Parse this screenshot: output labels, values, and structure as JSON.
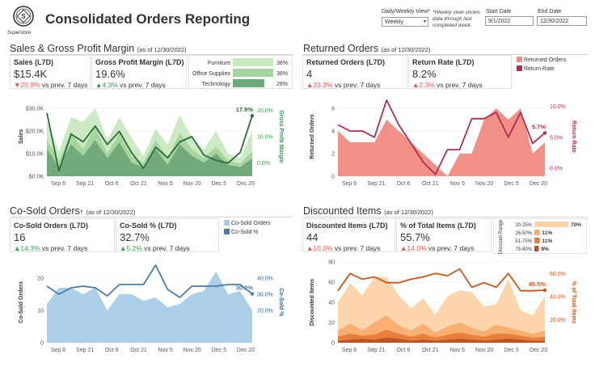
{
  "header": {
    "logo_text": "Superstore",
    "title": "Consolidated Orders Reporting",
    "view_label": "Daily/Weekly View*",
    "view_value": "Weekly",
    "note": "*Weekly view shows data through last completed week.",
    "start_label": "Start Date",
    "start_value": "9/1/2022",
    "end_label": "End Date",
    "end_value": "12/30/2022"
  },
  "sales": {
    "title": "Sales & Gross Profit Margin",
    "asof": "(as of 12/30/2022)",
    "kpi1": {
      "label": "Sales (L7D)",
      "value": "$15.4K",
      "arrow": "▼",
      "pct": "20.9%",
      "suffix": " vs prev. 7 days"
    },
    "kpi2": {
      "label": "Gross Profit Margin (L7D)",
      "value": "19.6%",
      "arrow": "▲",
      "pct": "4.3%",
      "suffix": " vs prev. 7 days"
    },
    "categories": [
      {
        "name": "Furniture",
        "pct": "36%",
        "share": 0.36,
        "color": "#c8e8c0"
      },
      {
        "name": "Office Supplies",
        "pct": "36%",
        "share": 0.36,
        "color": "#a3d49b"
      },
      {
        "name": "Technology",
        "pct": "28%",
        "share": 0.28,
        "color": "#6fa87a"
      }
    ]
  },
  "returns": {
    "title": "Returned Orders",
    "asof": "(as of 12/30/2022)",
    "kpi1": {
      "label": "Returned Orders (L7D)",
      "value": "4",
      "arrow": "▲",
      "pct": "33.3%",
      "suffix": " vs prev. 7 days"
    },
    "kpi2": {
      "label": "Return Rate (L7D)",
      "value": "8.2%",
      "arrow": "▲",
      "pct": "2.3%",
      "suffix": " vs prev. 7 days"
    },
    "legend": [
      {
        "name": "Returned Orders",
        "color": "#f08a80"
      },
      {
        "name": "Return Rate",
        "color": "#b32d4e"
      }
    ]
  },
  "cosold": {
    "title": "Co-Sold Orders",
    "dagger": "†",
    "asof": "(as of 12/30/2022)",
    "kpi1": {
      "label": "Co-Sold Orders (L7D)",
      "value": "16",
      "arrow": "▲",
      "pct": "14.3%",
      "suffix": " vs prev. 7 days"
    },
    "kpi2": {
      "label": "Co-Sold % (L7D)",
      "value": "32.7%",
      "arrow": "▲",
      "pct": "5.2%",
      "suffix": " vs prev. 7 days"
    },
    "legend": [
      {
        "name": "Co-Sold Orders",
        "color": "#a9cbe6"
      },
      {
        "name": "Co-Sold %",
        "color": "#4a7cab"
      }
    ]
  },
  "discount": {
    "title": "Discounted Items",
    "asof": "(as of 12/30/2022)",
    "kpi1": {
      "label": "Discounted Items (L7D)",
      "value": "44",
      "arrow": "▲",
      "pct": "10.0%",
      "suffix": " vs prev. 7 days"
    },
    "kpi2": {
      "label": "% of Total Items (L7D)",
      "value": "55.7%",
      "arrow": "▲",
      "pct": "14.0%",
      "suffix": " vs prev. 7 days"
    },
    "range_title": "Discount Range",
    "ranges": [
      {
        "name": "10-25%",
        "pct": "70%",
        "share": 0.7,
        "color": "#fcd3a8"
      },
      {
        "name": "26-50%",
        "pct": "11%",
        "share": 0.11,
        "color": "#f8ad6e"
      },
      {
        "name": "51-75%",
        "pct": "11%",
        "share": 0.11,
        "color": "#e67c3a"
      },
      {
        "name": "75-80%",
        "pct": "9%",
        "share": 0.09,
        "color": "#b5552a"
      }
    ]
  },
  "chart_data": [
    {
      "type": "area",
      "title": "Sales & Gross Profit Margin",
      "x_ticks": [
        "Sep 6",
        "Sep 21",
        "Oct 6",
        "Oct 21",
        "Nov 5",
        "Nov 20",
        "Dec 5",
        "Dec 20"
      ],
      "ylabel": "Sales",
      "ylim": [
        0,
        35000
      ],
      "y_ticks": [
        "$0.0K",
        "$10.0K",
        "$20.0K",
        "$30.0K"
      ],
      "y2label": "Gross Profit Margin",
      "y2lim": [
        -5,
        25
      ],
      "y2_ticks": [
        "0.0%",
        "10.0%",
        "20.0%"
      ],
      "stacked": true,
      "series": [
        {
          "name": "Technology",
          "color": "#6fa87a",
          "values": [
            12000,
            4000,
            14000,
            9000,
            16000,
            8000,
            15000,
            6000,
            4000,
            12000,
            5000,
            14000,
            9000,
            6000,
            10000,
            5000,
            4000,
            8000
          ]
        },
        {
          "name": "Office Supplies",
          "color": "#a3d49b",
          "values": [
            4000,
            3000,
            5000,
            3000,
            6000,
            2000,
            4000,
            3000,
            2000,
            4000,
            3000,
            5000,
            3000,
            2000,
            3000,
            2000,
            1500,
            3000
          ]
        },
        {
          "name": "Furniture",
          "color": "#c8e8c0",
          "values": [
            8000,
            4000,
            7000,
            12000,
            8000,
            6000,
            7000,
            8000,
            3000,
            5000,
            6000,
            8000,
            5000,
            4000,
            7000,
            3000,
            2500,
            9000
          ]
        }
      ],
      "line": {
        "name": "Gross Profit Margin",
        "color": "#2d6b3c",
        "values": [
          19,
          -3,
          11,
          8,
          14,
          7,
          12,
          4,
          -2,
          6,
          2,
          8,
          10,
          3,
          1,
          0,
          4,
          17.9
        ],
        "end_label": "17.9%"
      }
    },
    {
      "type": "area",
      "title": "Returned Orders",
      "x_ticks": [
        "Sep 6",
        "Sep 21",
        "Oct 6",
        "Oct 21",
        "Nov 5",
        "Nov 20",
        "Dec 5",
        "Dec 20"
      ],
      "ylabel": "Returned Orders",
      "ylim": [
        0,
        7
      ],
      "y_ticks": [
        "0",
        "2",
        "4",
        "6"
      ],
      "y2label": "Return Rate",
      "y2lim": [
        -1.3,
        11.5
      ],
      "y2_ticks": [
        "0.0%",
        "5.0%",
        "10.0%"
      ],
      "area": {
        "name": "Returned Orders",
        "color": "#f08a80",
        "values": [
          4,
          3,
          3,
          3,
          5,
          4,
          3,
          2,
          1,
          0,
          2,
          2,
          5,
          6,
          5,
          6,
          2,
          3
        ]
      },
      "line": {
        "name": "Return Rate",
        "color": "#b32d4e",
        "values": [
          7,
          6,
          6,
          5,
          11,
          7,
          4,
          1,
          -1,
          3,
          3,
          8,
          8,
          9,
          5,
          9,
          4,
          5.7
        ],
        "end_label": "5.7%"
      }
    },
    {
      "type": "area",
      "title": "Co-Sold Orders",
      "x_ticks": [
        "Sep 6",
        "Sep 21",
        "Oct 6",
        "Oct 21",
        "Nov 5",
        "Nov 20",
        "Dec 5",
        "Dec 20"
      ],
      "ylabel": "Co-Sold Orders",
      "ylim": [
        0,
        25
      ],
      "y_ticks": [
        "0",
        "10",
        "20"
      ],
      "y2label": "Co-Sold %",
      "y2lim": [
        0,
        50
      ],
      "y2_ticks": [
        "20.0%",
        "30.0%",
        "40.0%"
      ],
      "area": {
        "name": "Co-Sold Orders",
        "color": "#a9cbe6",
        "values": [
          12,
          17,
          17,
          15,
          17,
          10,
          15,
          15,
          13,
          14,
          11,
          12,
          15,
          16,
          22,
          15,
          16,
          10
        ]
      },
      "line": {
        "name": "Co-Sold %",
        "color": "#4a7cab",
        "values": [
          35,
          30,
          34,
          35,
          34,
          29,
          36,
          36,
          36,
          48,
          33,
          28,
          35,
          35,
          35,
          36,
          36,
          30.2
        ],
        "end_label": "30.2%"
      }
    },
    {
      "type": "area",
      "title": "Discounted Items",
      "x_ticks": [
        "Sep 6",
        "Sep 21",
        "Oct 6",
        "Oct 21",
        "Nov 5",
        "Nov 20",
        "Dec 5",
        "Dec 20"
      ],
      "ylabel": "Discounted Items",
      "ylim": [
        0,
        80
      ],
      "y_ticks": [
        "0",
        "20",
        "40",
        "60",
        "80"
      ],
      "y2label": "% of Total Items",
      "y2lim": [
        0,
        70
      ],
      "y2_ticks": [
        "20.0%",
        "40.0%",
        "60.0%"
      ],
      "stacked": true,
      "series": [
        {
          "name": "75-80%",
          "color": "#b5552a",
          "values": [
            2,
            3,
            4,
            3,
            5,
            4,
            2,
            3,
            2,
            3,
            4,
            3,
            2,
            3,
            4,
            3,
            2,
            2
          ]
        },
        {
          "name": "51-75%",
          "color": "#e67c3a",
          "values": [
            4,
            6,
            3,
            5,
            8,
            5,
            4,
            6,
            3,
            5,
            6,
            5,
            4,
            6,
            5,
            4,
            3,
            4
          ]
        },
        {
          "name": "26-50%",
          "color": "#f8ad6e",
          "values": [
            6,
            10,
            5,
            12,
            14,
            8,
            6,
            10,
            5,
            8,
            10,
            7,
            5,
            9,
            6,
            5,
            4,
            6
          ]
        },
        {
          "name": "10-25%",
          "color": "#fcd3a8",
          "values": [
            28,
            40,
            35,
            45,
            38,
            30,
            22,
            25,
            18,
            30,
            32,
            35,
            25,
            20,
            48,
            20,
            18,
            34
          ]
        }
      ],
      "line": {
        "name": "% of Total Items",
        "color": "#c8561e",
        "values": [
          45,
          60,
          55,
          57,
          52,
          52,
          55,
          57,
          60,
          58,
          64,
          48,
          52,
          48,
          60,
          45,
          45,
          45.5
        ],
        "end_label": "45.5%"
      }
    }
  ]
}
